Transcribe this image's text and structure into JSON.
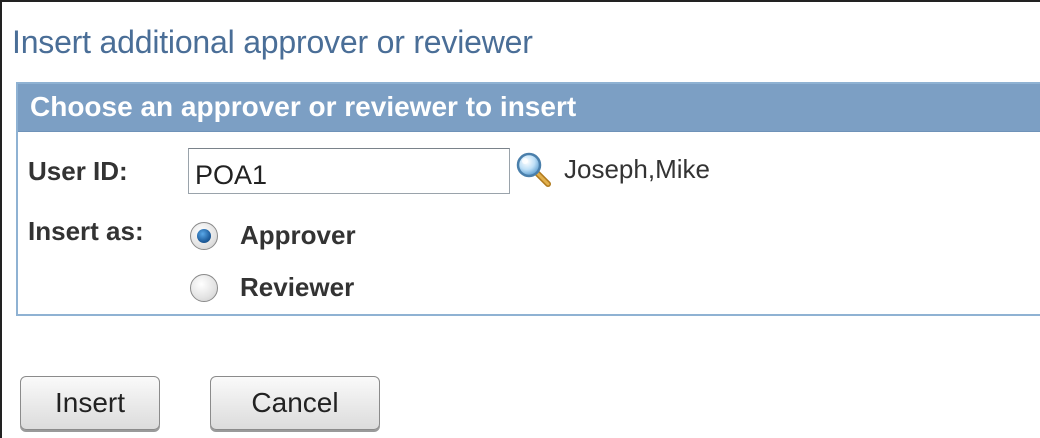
{
  "page_title": "Insert additional approver or reviewer",
  "group": {
    "header": "Choose an approver or reviewer to insert"
  },
  "user_id": {
    "label": "User ID:",
    "value": "POA1",
    "lookup_icon": "magnifier-lookup-icon",
    "description": "Joseph,Mike"
  },
  "insert_as": {
    "label": "Insert as:",
    "options": [
      {
        "label": "Approver",
        "selected": true
      },
      {
        "label": "Reviewer",
        "selected": false
      }
    ]
  },
  "buttons": {
    "insert": "Insert",
    "cancel": "Cancel"
  },
  "colors": {
    "title": "#4a6e97",
    "header_bg": "#7c9fc4",
    "group_border": "#8fb2d3"
  }
}
